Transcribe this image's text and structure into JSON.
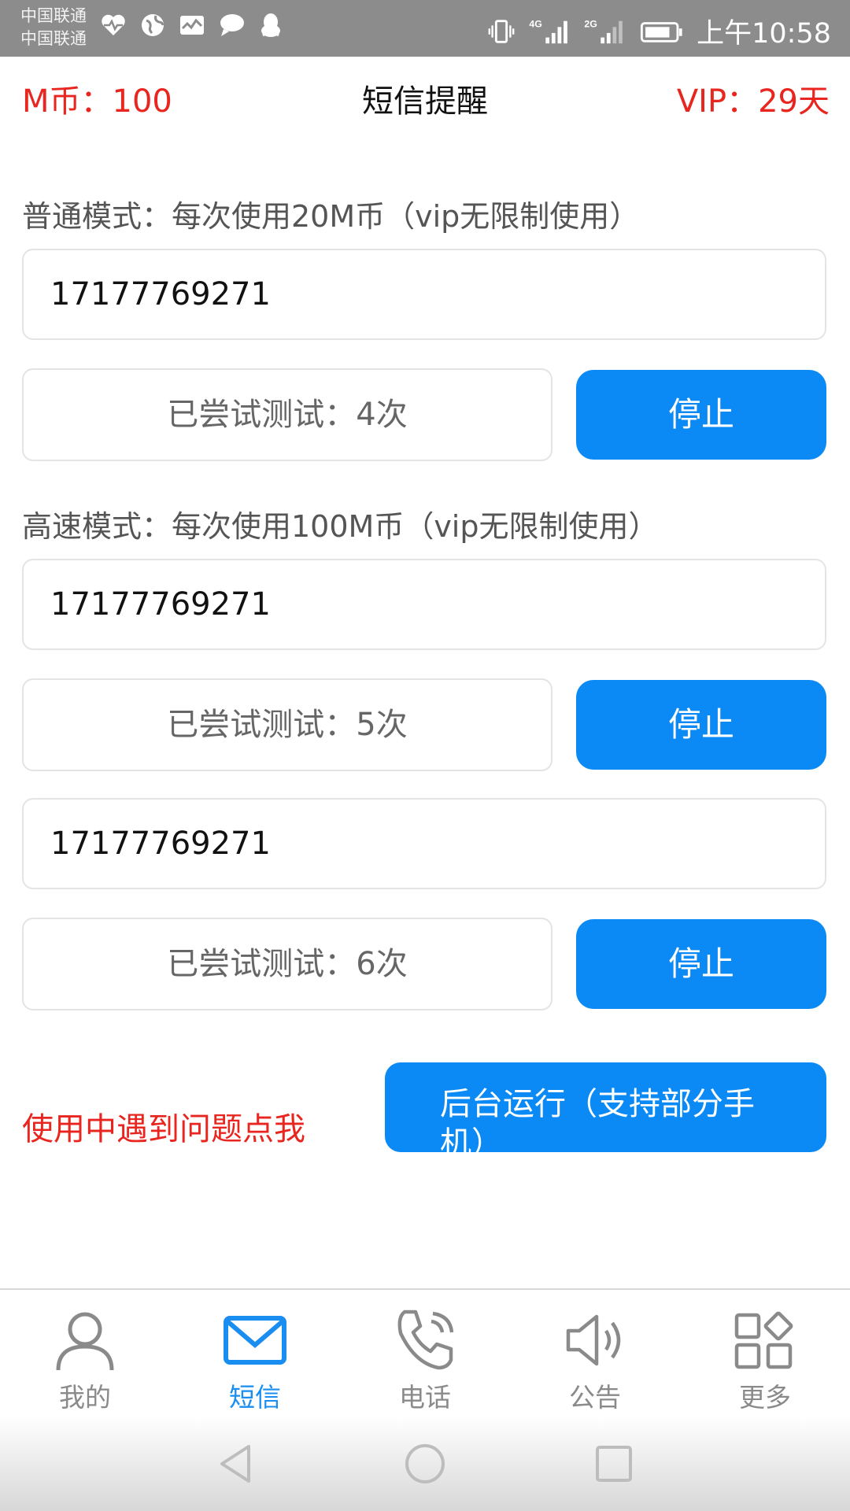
{
  "status_bar": {
    "carrier_1": "中国联通",
    "carrier_2": "中国联通",
    "network_1": "4G",
    "network_2": "2G",
    "time": "上午10:58",
    "icons": [
      "heartbeat-icon",
      "globe-icon",
      "activity-monitor-icon",
      "chat-bubble-icon",
      "qq-penguin-icon",
      "vibrate-icon",
      "signal-icon",
      "battery-icon"
    ]
  },
  "header": {
    "coins": "M币：100",
    "title": "短信提醒",
    "vip": "VIP：29天"
  },
  "normal_mode": {
    "label": "普通模式：每次使用20M币（vip无限制使用）",
    "phone": "17177769271",
    "tries": "已尝试测试：4次",
    "stop_label": "停止"
  },
  "fast_mode": {
    "label": "高速模式：每次使用100M币（vip无限制使用）",
    "entries": [
      {
        "phone": "17177769271",
        "tries": "已尝试测试：5次",
        "stop_label": "停止"
      },
      {
        "phone": "17177769271",
        "tries": "已尝试测试：6次",
        "stop_label": "停止"
      }
    ]
  },
  "help_link": "使用中遇到问题点我",
  "background_button": "后台运行（支持部分手机）",
  "bottom_nav": [
    {
      "label": "我的",
      "icon": "person-icon",
      "active": false
    },
    {
      "label": "短信",
      "icon": "envelope-icon",
      "active": true
    },
    {
      "label": "电话",
      "icon": "phone-icon",
      "active": false
    },
    {
      "label": "公告",
      "icon": "speaker-icon",
      "active": false
    },
    {
      "label": "更多",
      "icon": "grid-more-icon",
      "active": false
    }
  ],
  "colors": {
    "accent_blue": "#0b8af5",
    "active_tab": "#1a8df0",
    "alert_red": "#e8261f",
    "status_bar": "#8c8c8c"
  }
}
